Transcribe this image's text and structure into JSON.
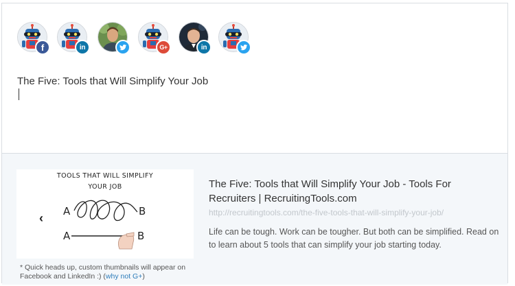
{
  "profiles": [
    {
      "avatar": "robot-avatar",
      "network": "facebook",
      "badge_icon": "facebook-icon",
      "badge_glyph": "f"
    },
    {
      "avatar": "robot-avatar",
      "network": "linkedin",
      "badge_icon": "linkedin-icon",
      "badge_glyph": "in"
    },
    {
      "avatar": "person-avatar-1",
      "network": "twitter",
      "badge_icon": "twitter-icon",
      "badge_glyph": ""
    },
    {
      "avatar": "robot-avatar",
      "network": "google-plus",
      "badge_icon": "google-plus-icon",
      "badge_glyph": "G+"
    },
    {
      "avatar": "person-avatar-2",
      "network": "linkedin",
      "badge_icon": "linkedin-icon",
      "badge_glyph": "in"
    },
    {
      "avatar": "robot-avatar",
      "network": "twitter",
      "badge_icon": "twitter-icon",
      "badge_glyph": ""
    }
  ],
  "composer": {
    "text": "The Five: Tools that Will Simplify Your Job"
  },
  "preview": {
    "thumbnail": {
      "title_line1": "TOOLS THAT WILL SIMPLIFY",
      "title_line2": "YOUR JOB",
      "label_a1": "A",
      "label_b1": "B",
      "label_a2": "A",
      "label_b2": "B"
    },
    "prev_arrow": "‹",
    "next_arrow": "›",
    "note_text": "* Quick heads up, custom thumbnails will appear on Facebook and LinkedIn :) (",
    "note_link": "why not G+",
    "note_end": ")",
    "link_title": "The Five: Tools that Will Simplify Your Job - Tools For Recruiters | RecruitingTools.com",
    "link_url": "http://recruitingtools.com/the-five-tools-that-will-simplify-your-job/",
    "link_description": "Life can be tough. Work can be tougher. But both can be simplified. Read on to learn about 5 tools that can simplify your job starting today."
  },
  "colors": {
    "facebook": "#3b5998",
    "linkedin": "#0e76a8",
    "twitter": "#2aa3ef",
    "google_plus": "#dd4b39",
    "link": "#2b7bb9",
    "preview_bg": "#f4f7fa"
  }
}
